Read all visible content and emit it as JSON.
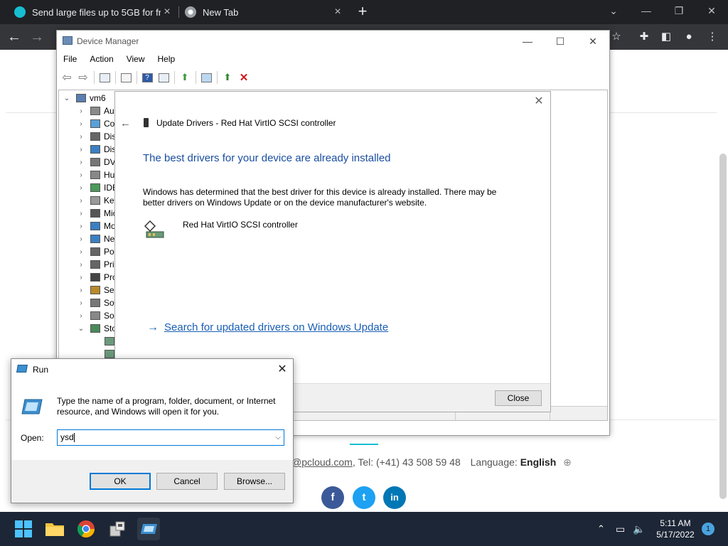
{
  "browser": {
    "tabs": [
      {
        "title": "Send large files up to 5GB for fre",
        "favicon": "pcloud-icon",
        "active": true
      },
      {
        "title": "New Tab",
        "favicon": "chrome-icon",
        "active": false
      }
    ],
    "new_tab": "+",
    "window_controls": {
      "minimize": "⌄",
      "min": "—",
      "restore": "❐",
      "close": "✕"
    }
  },
  "webpage": {
    "contact_email": "@pcloud.com",
    "contact_tel": "Tel: (+41) 43 508 59 48",
    "language_label": "Language:",
    "language_value": "English",
    "social": [
      "f",
      "t",
      "in"
    ]
  },
  "device_manager": {
    "title": "Device Manager",
    "menus": [
      "File",
      "Action",
      "View",
      "Help"
    ],
    "tree": {
      "root": "vm6",
      "items": [
        "Auc",
        "Cor",
        "Disk",
        "Disp",
        "DVD",
        "Hun",
        "IDE",
        "Key",
        "Mic",
        "Mo",
        "Net",
        "Por",
        "Prin",
        "Pro",
        "Sec",
        "Soft",
        "Sou",
        "Stor"
      ]
    }
  },
  "update_drivers": {
    "window_title": "Update Drivers - Red Hat VirtIO SCSI controller",
    "heading": "The best drivers for your device are already installed",
    "description": "Windows has determined that the best driver for this device is already installed. There may be better drivers on Windows Update or on the device manufacturer's website.",
    "device_name": "Red Hat VirtIO SCSI controller",
    "link": "Search for updated drivers on Windows Update",
    "close_button": "Close"
  },
  "run_dialog": {
    "title": "Run",
    "description": "Type the name of a program, folder, document, or Internet resource, and Windows will open it for you.",
    "open_label": "Open:",
    "input_value": "ysd",
    "buttons": {
      "ok": "OK",
      "cancel": "Cancel",
      "browse": "Browse..."
    }
  },
  "taskbar": {
    "time": "5:11 AM",
    "date": "5/17/2022",
    "notification_count": "1"
  },
  "colors": {
    "link_blue": "#1a5fb4",
    "heading_blue": "#1a4ea0",
    "facebook": "#3b5998",
    "twitter": "#1da1f2",
    "linkedin": "#0077b5",
    "accent": "#17bed0"
  }
}
